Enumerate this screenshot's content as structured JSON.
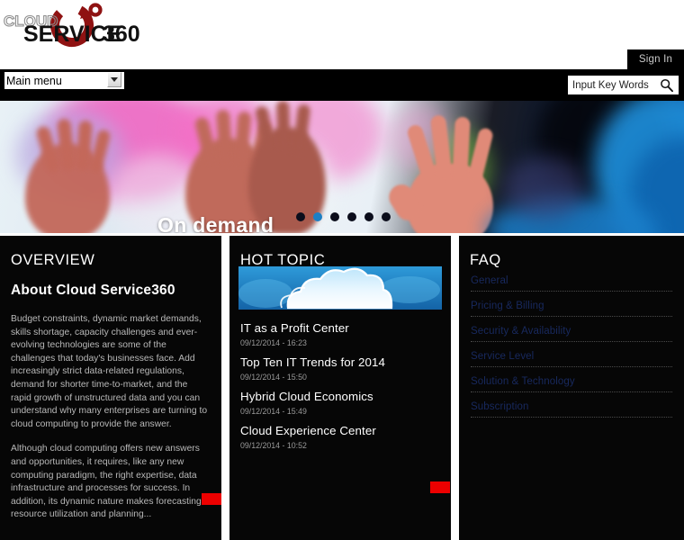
{
  "site": {
    "logo": {
      "word_top": "CLOUD",
      "word_main": "SERVICE",
      "word_num": "360",
      "ring_color": "#8f1212"
    }
  },
  "header": {
    "signin_label": "Sign In"
  },
  "nav": {
    "menu_selected": "Main menu",
    "menu_options": [
      "Main menu"
    ],
    "search_placeholder": "Input Key Words",
    "search_value": "",
    "search_icon": "search-icon"
  },
  "banner": {
    "caption": "On demand",
    "dots": [
      {
        "active": false
      },
      {
        "active": true
      },
      {
        "active": false
      },
      {
        "active": false
      },
      {
        "active": false
      },
      {
        "active": false
      }
    ],
    "active_dot_color": "#1d7fc4",
    "dot_color": "#0b0d1b"
  },
  "overview": {
    "title": "OVERVIEW",
    "heading": "About Cloud Service360",
    "paragraph1": "Budget constraints, dynamic market demands, skills shortage, capacity challenges and ever-evolving technologies are some of the challenges that today's businesses face.  Add increasingly strict data-related regulations, demand for shorter time-to-market, and the rapid growth of unstructured data and you can understand why many enterprises are turning to cloud computing to provide the answer.",
    "paragraph2": "Although cloud computing offers new answers and opportunities, it requires, like any new computing paradigm, the right expertise, data infrastructure and processes for success. In addition, its dynamic nature makes forecasting resource utilization and planning...",
    "more_button_label": "",
    "more_button_color": "#ed0000"
  },
  "hot_topic": {
    "title": "HOT TOPIC",
    "image_alt": "cloud-illustration",
    "items": [
      {
        "title": "IT as a Profit Center",
        "date": "09/12/2014 - 16:23"
      },
      {
        "title": "Top Ten IT Trends for 2014",
        "date": "09/12/2014 - 15:50"
      },
      {
        "title": "Hybrid Cloud Economics",
        "date": "09/12/2014 - 15:49"
      },
      {
        "title": "Cloud Experience Center",
        "date": "09/12/2014 - 10:52"
      }
    ],
    "more_button_label": "",
    "more_button_color": "#ed0000"
  },
  "faq": {
    "title": "FAQ",
    "link_color": "#18295e",
    "items": [
      {
        "label": "General"
      },
      {
        "label": "Pricing & Billing"
      },
      {
        "label": "Security & Availability"
      },
      {
        "label": "Service Level"
      },
      {
        "label": "Solution & Technology"
      },
      {
        "label": "Subscription"
      }
    ]
  }
}
